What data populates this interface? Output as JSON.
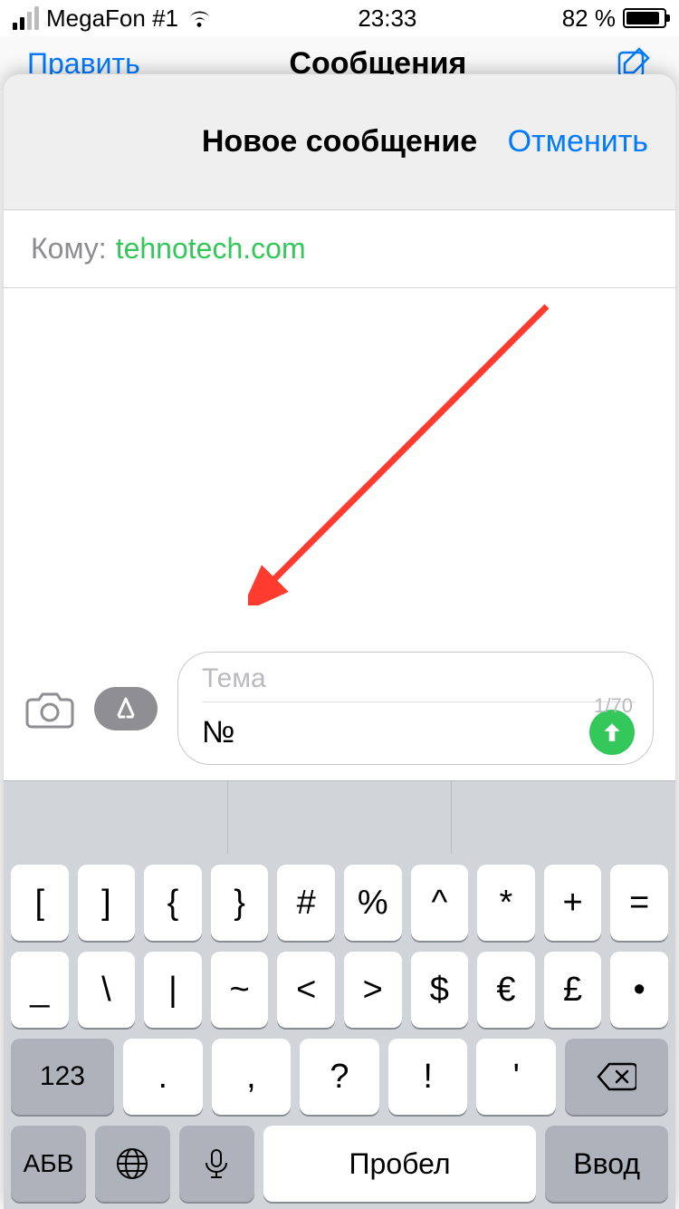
{
  "status": {
    "carrier": "MegaFon #1",
    "time": "23:33",
    "battery_pct": "82 %"
  },
  "under": {
    "edit": "Править",
    "title": "Сообщения"
  },
  "sheet": {
    "title": "Новое сообщение",
    "cancel": "Отменить",
    "to_label": "Кому:",
    "to_value": "tehnotech.com",
    "subject_placeholder": "Тема",
    "message_body": "№",
    "char_counter": "1/70"
  },
  "keyboard": {
    "row1": [
      "[",
      "]",
      "{",
      "}",
      "#",
      "%",
      "^",
      "*",
      "+",
      "="
    ],
    "row2": [
      "_",
      "\\",
      "|",
      "~",
      "<",
      ">",
      "$",
      "€",
      "£",
      "•"
    ],
    "row3_keys": [
      ".",
      ",",
      "?",
      "!",
      "'"
    ],
    "num_label": "123",
    "abc_label": "АБВ",
    "space_label": "Пробел",
    "enter_label": "Ввод"
  }
}
